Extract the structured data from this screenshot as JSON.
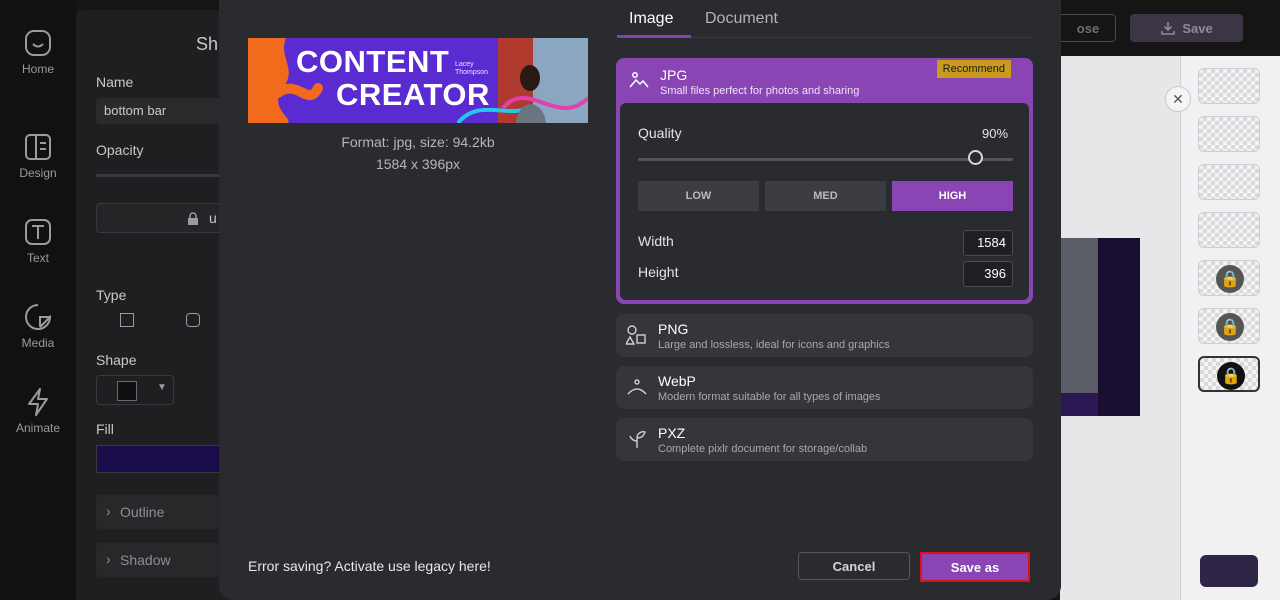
{
  "nav": {
    "items": [
      {
        "label": "Home",
        "icon": "home-icon"
      },
      {
        "label": "Design",
        "icon": "design-icon"
      },
      {
        "label": "Text",
        "icon": "text-icon"
      },
      {
        "label": "Media",
        "icon": "media-icon"
      },
      {
        "label": "Animate",
        "icon": "animate-icon"
      }
    ]
  },
  "panel": {
    "title": "Sh",
    "name_label": "Name",
    "name_value": "bottom bar",
    "opacity_label": "Opacity",
    "lock_text": "u",
    "type_label": "Type",
    "shape_label": "Shape",
    "fill_label": "Fill",
    "outline_label": "Outline",
    "shadow_label": "Shadow"
  },
  "topbar": {
    "close_label": "ose",
    "save_label": "Save"
  },
  "modal": {
    "preview": {
      "headline1": "CONTENT",
      "headline2": "CREATOR",
      "name_line1": "Lacey",
      "name_line2": "Thompson",
      "format_info": "Format: jpg, size: 94.2kb",
      "dimensions": "1584 x 396px"
    },
    "tabs": [
      {
        "label": "Image",
        "active": true
      },
      {
        "label": "Document",
        "active": false
      }
    ],
    "formats": [
      {
        "name": "JPG",
        "desc": "Small files perfect for photos and sharing",
        "icon": "image-icon",
        "selected": true,
        "badge": "Recommend"
      },
      {
        "name": "PNG",
        "desc": "Large and lossless, ideal for icons and graphics",
        "icon": "shapes-icon",
        "selected": false
      },
      {
        "name": "WebP",
        "desc": "Modern format suitable for all types of images",
        "icon": "webp-icon",
        "selected": false
      },
      {
        "name": "PXZ",
        "desc": "Complete pixlr document for storage/collab",
        "icon": "sprout-icon",
        "selected": false
      }
    ],
    "jpg_settings": {
      "quality_label": "Quality",
      "quality_value": "90%",
      "quality_level": 0.9,
      "presets": [
        "LOW",
        "MED",
        "HIGH"
      ],
      "active_preset": "HIGH",
      "width_label": "Width",
      "width_value": "1584",
      "height_label": "Height",
      "height_value": "396"
    },
    "legacy_text": "Error saving? Activate use legacy here!",
    "cancel_label": "Cancel",
    "save_as_label": "Save as"
  },
  "colors": {
    "accent": "#8a45b5",
    "badge": "#c99a1c",
    "highlight": "#e0101a"
  }
}
